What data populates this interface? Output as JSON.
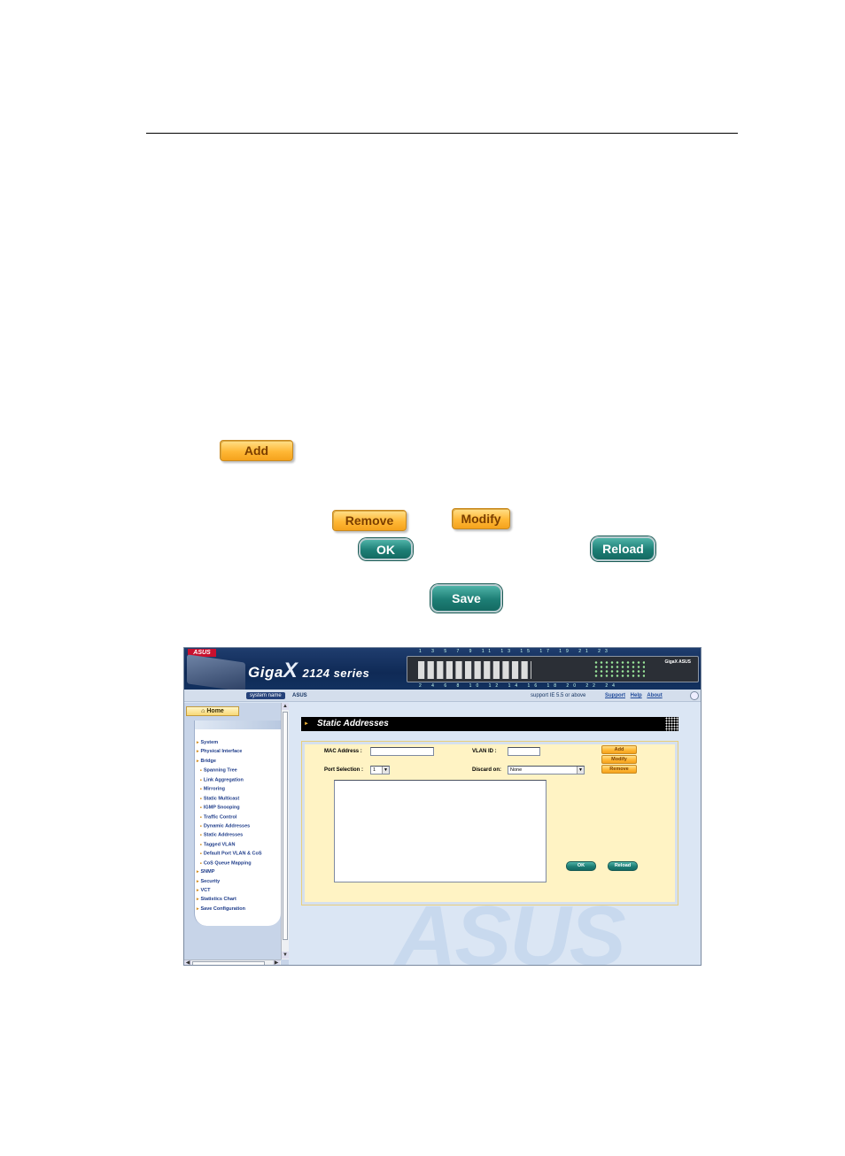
{
  "doc_buttons": {
    "add": "Add",
    "remove": "Remove",
    "modify": "Modify",
    "ok": "OK",
    "reload": "Reload",
    "save": "Save"
  },
  "screenshot": {
    "brand": {
      "logo": "ASUS",
      "product": "Giga",
      "product_x": "X",
      "series": "2124 series",
      "panel_brand": "GigaX ASUS",
      "port_numbers_top": "1 3 5 7 9 11 13 15 17 19 21 23",
      "port_numbers_bottom": "2 4 6 8 10 12 14 16 18 20 22 24"
    },
    "topbar": {
      "system_name_label": "system name",
      "system_name_value": "ASUS",
      "support_note": "support IE 5.5 or above",
      "links": [
        "Support",
        "Help",
        "About"
      ]
    },
    "sidebar": {
      "home": "Home",
      "items": [
        {
          "label": "System",
          "level": 1
        },
        {
          "label": "Physical Interface",
          "level": 1
        },
        {
          "label": "Bridge",
          "level": 1
        },
        {
          "label": "Spanning Tree",
          "level": 2
        },
        {
          "label": "Link Aggregation",
          "level": 2
        },
        {
          "label": "Mirroring",
          "level": 2
        },
        {
          "label": "Static Multicast",
          "level": 2
        },
        {
          "label": "IGMP Snooping",
          "level": 2
        },
        {
          "label": "Traffic Control",
          "level": 2
        },
        {
          "label": "Dynamic Addresses",
          "level": 2
        },
        {
          "label": "Static Addresses",
          "level": 2
        },
        {
          "label": "Tagged VLAN",
          "level": 2
        },
        {
          "label": "Default Port VLAN & CoS",
          "level": 2
        },
        {
          "label": "CoS Queue Mapping",
          "level": 2
        },
        {
          "label": "SNMP",
          "level": 1
        },
        {
          "label": "Security",
          "level": 1
        },
        {
          "label": "VCT",
          "level": 1
        },
        {
          "label": "Statistics Chart",
          "level": 1
        },
        {
          "label": "Save Configuration",
          "level": 1
        }
      ]
    },
    "main": {
      "title": "Static Addresses",
      "mac_label": "MAC Address :",
      "mac_value": "",
      "vlan_label": "VLAN ID :",
      "vlan_value": "",
      "port_label": "Port Selection :",
      "port_value": "1",
      "discard_label": "Discard on:",
      "discard_value": "None",
      "btn_add": "Add",
      "btn_modify": "Modify",
      "btn_remove": "Remove",
      "btn_ok": "OK",
      "btn_reload": "Reload",
      "watermark": "ASUS"
    }
  }
}
